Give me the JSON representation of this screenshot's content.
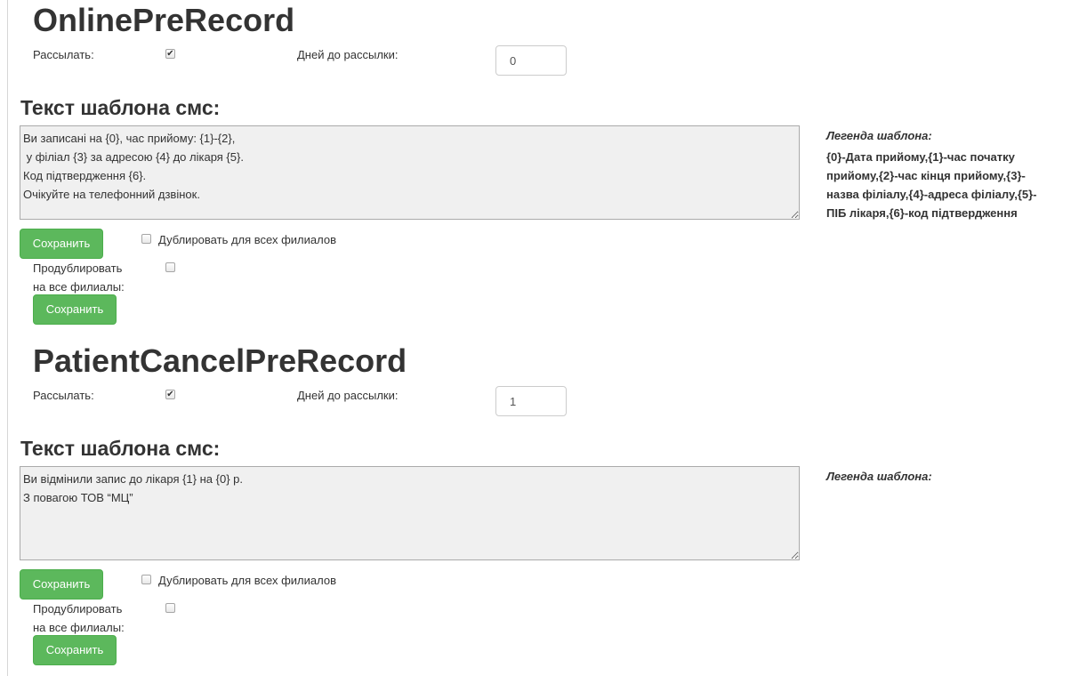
{
  "sections": [
    {
      "title": "OnlinePreRecord",
      "send_label": "Рассылать:",
      "send_checked": true,
      "days_label": "Дней до рассылки:",
      "days_value": "0",
      "template_title": "Текст шаблона смс:",
      "template_text": "Ви записані на {0}, час прийому: {1}-{2},\n у філіал {3} за адресою {4} до лікаря {5}.\nКод підтвердження {6}.\nОчікуйте на телефонний дзвінок.",
      "legend_title": "Легенда шаблона:",
      "legend_text": "{0}-Дата прийому,{1}-час початку прийому,{2}-час кінця прийому,{3}-назва філіалу,{4}-адреса філіалу,{5}-ПІБ лікаря,{6}-код підтвердження",
      "save_label": "Сохранить",
      "duplicate_all_label": "Дублировать для всех филиалов",
      "duplicate_all_checked": false,
      "reduplicate_label_line1": "Продублировать",
      "reduplicate_label_line2": "на все филиалы:",
      "reduplicate_checked": false,
      "save2_label": "Сохранить"
    },
    {
      "title": "PatientCancelPreRecord",
      "send_label": "Рассылать:",
      "send_checked": true,
      "days_label": "Дней до рассылки:",
      "days_value": "1",
      "template_title": "Текст шаблона смс:",
      "template_text": "Ви відмінили запис до лікаря {1} на {0} р.\nЗ повагою ТОВ “МЦ”",
      "legend_title": "Легенда шаблона:",
      "legend_text": "",
      "save_label": "Сохранить",
      "duplicate_all_label": "Дублировать для всех филиалов",
      "duplicate_all_checked": false,
      "reduplicate_label_line1": "Продублировать",
      "reduplicate_label_line2": "на все филиалы:",
      "reduplicate_checked": false,
      "save2_label": "Сохранить"
    }
  ],
  "colors": {
    "accent_green": "#5cb85c",
    "textarea_bg": "#f0f0f0",
    "text": "#333333"
  }
}
